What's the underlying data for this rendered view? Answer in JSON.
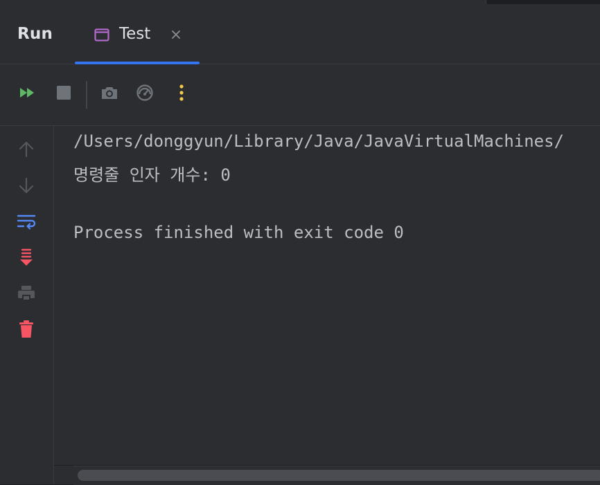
{
  "panel": {
    "title": "Run"
  },
  "tab": {
    "label": "Test",
    "close_glyph": "×",
    "icon": "window-icon",
    "icon_color": "#b16ac9"
  },
  "toolbar": {
    "items": [
      {
        "name": "rerun-button",
        "icon": "rerun-icon",
        "color": "#5fb865"
      },
      {
        "name": "stop-button",
        "icon": "stop-icon",
        "color": "#6f737a"
      },
      {
        "name": "screenshot-button",
        "icon": "camera-icon",
        "color": "#6f737a"
      },
      {
        "name": "profiler-button",
        "icon": "gauge-icon",
        "color": "#6f737a"
      },
      {
        "name": "more-options-button",
        "icon": "more-vertical-icon",
        "color": "#f2c94c"
      }
    ]
  },
  "gutter": {
    "items": [
      {
        "name": "scroll-up-button",
        "icon": "arrow-up-icon",
        "color": "#55575c"
      },
      {
        "name": "scroll-down-button",
        "icon": "arrow-down-icon",
        "color": "#55575c"
      },
      {
        "name": "soft-wrap-button",
        "icon": "soft-wrap-icon",
        "color": "#548af7"
      },
      {
        "name": "scroll-to-end-button",
        "icon": "scroll-to-end-icon",
        "color": "#f75464"
      },
      {
        "name": "print-button",
        "icon": "print-icon",
        "color": "#55575c"
      },
      {
        "name": "clear-all-button",
        "icon": "trash-icon",
        "color": "#f75464"
      }
    ]
  },
  "console": {
    "lines": [
      "/Users/donggyun/Library/Java/JavaVirtualMachines/",
      "명령줄 인자 개수: 0",
      "",
      "Process finished with exit code 0"
    ]
  }
}
